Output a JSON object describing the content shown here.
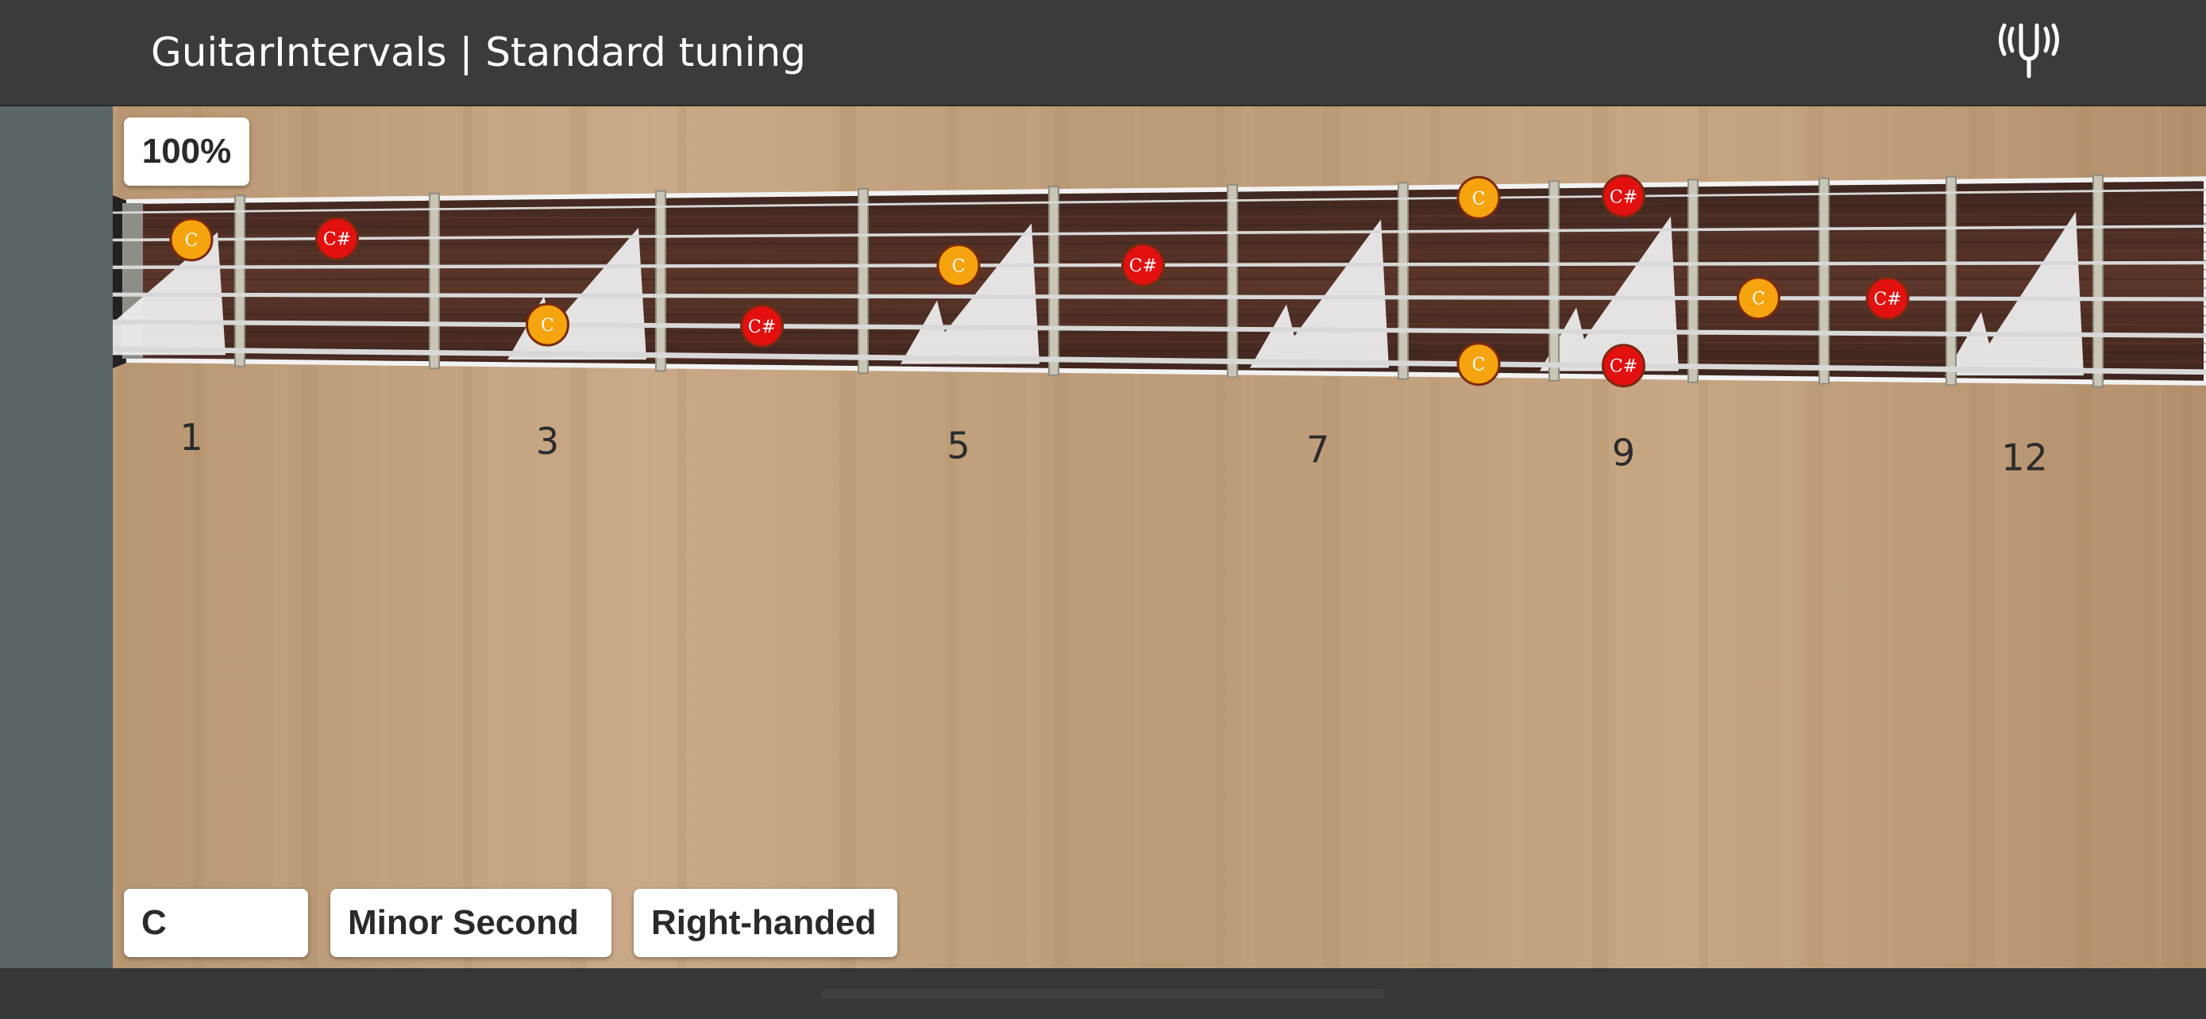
{
  "header": {
    "title": "GuitarIntervals | Standard tuning",
    "tuner_icon": "tuning-fork-icon"
  },
  "zoom": {
    "label": "100%"
  },
  "controls": {
    "root_note": "C",
    "interval": "Minor Second",
    "handedness": "Right-handed"
  },
  "fretboard": {
    "fret_markers": [
      "1",
      "3",
      "5",
      "7",
      "9",
      "12"
    ],
    "notes": [
      {
        "label": "C",
        "type": "root",
        "fret": 1,
        "string": 2
      },
      {
        "label": "C#",
        "type": "interval",
        "fret": 2,
        "string": 2
      },
      {
        "label": "C",
        "type": "root",
        "fret": 3,
        "string": 5
      },
      {
        "label": "C#",
        "type": "interval",
        "fret": 4,
        "string": 5
      },
      {
        "label": "C",
        "type": "root",
        "fret": 5,
        "string": 3
      },
      {
        "label": "C#",
        "type": "interval",
        "fret": 6,
        "string": 3
      },
      {
        "label": "C",
        "type": "root",
        "fret": 8,
        "string": 1
      },
      {
        "label": "C#",
        "type": "interval",
        "fret": 9,
        "string": 1
      },
      {
        "label": "C",
        "type": "root",
        "fret": 8,
        "string": 6
      },
      {
        "label": "C#",
        "type": "interval",
        "fret": 9,
        "string": 6
      },
      {
        "label": "C",
        "type": "root",
        "fret": 10,
        "string": 4
      },
      {
        "label": "C#",
        "type": "interval",
        "fret": 11,
        "string": 4
      }
    ]
  },
  "colors": {
    "root_note": "#f5a30f",
    "interval_note": "#e31010",
    "fretboard_wood": "#4a2a22",
    "header_bg": "#3b3b3b"
  }
}
